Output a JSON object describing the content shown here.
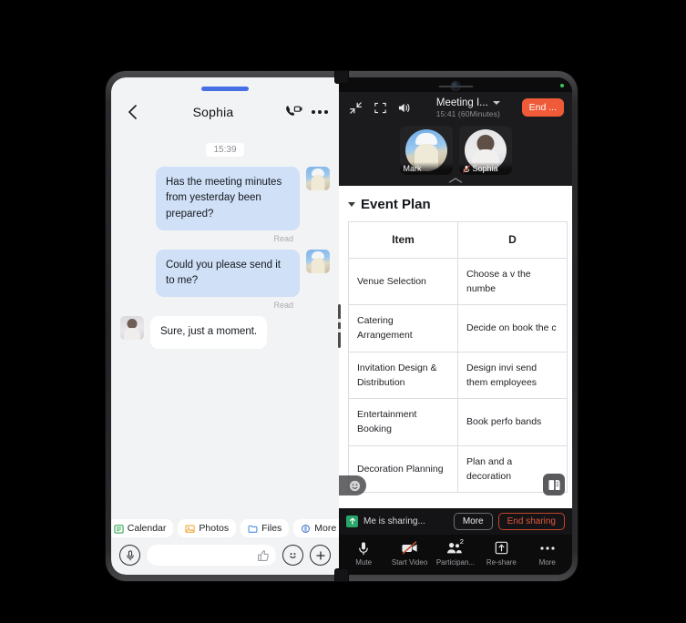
{
  "chat": {
    "title": "Sophia",
    "time_separator": "15:39",
    "messages": [
      {
        "sender": "Mark",
        "direction": "out",
        "text": "Has the meeting minutes from yesterday been prepared?",
        "status": "Read",
        "avatar": "mark-avatar"
      },
      {
        "sender": "Mark",
        "direction": "out",
        "text": "Could you please send it to me?",
        "status": "Read",
        "avatar": "mark-avatar"
      },
      {
        "sender": "Sophia",
        "direction": "in",
        "text": "Sure, just a moment.",
        "status": "",
        "avatar": "sophia-avatar"
      }
    ],
    "quick_actions": [
      {
        "label": "Calendar",
        "icon": "calendar-icon",
        "color": "#34a853"
      },
      {
        "label": "Photos",
        "icon": "photo-icon",
        "color": "#f0a83c"
      },
      {
        "label": "Files",
        "icon": "folder-icon",
        "color": "#4a90e2"
      },
      {
        "label": "More",
        "icon": "more-apps-icon",
        "color": "#4a78c8"
      }
    ],
    "composer": {
      "placeholder": "",
      "value": "",
      "mic_icon": "microphone-icon",
      "thumb_icon": "thumbs-up-icon",
      "emoji_icon": "emoji-icon",
      "plus_icon": "plus-icon"
    },
    "header_icons": {
      "back": "back-arrow-icon",
      "call": "video-call-icon",
      "more": "more-options-icon"
    }
  },
  "meeting": {
    "title": "Meeting I...",
    "timer": "15:41 (60Minutes)",
    "end_button": "End ...",
    "controls": {
      "minimize": "minimize-icon",
      "fullscreen": "fullscreen-icon",
      "speaker": "speaker-icon"
    },
    "participants": [
      {
        "name": "Mark",
        "muted": false,
        "avatar": "mark-avatar"
      },
      {
        "name": "Sophia",
        "muted": true,
        "avatar": "sophia-avatar"
      }
    ],
    "sharing": {
      "status": "Me is sharing...",
      "more_label": "More",
      "end_label": "End sharing"
    },
    "toolbar": [
      {
        "label": "Mute",
        "icon": "microphone-icon",
        "badge": ""
      },
      {
        "label": "Start Video",
        "icon": "video-off-icon",
        "badge": ""
      },
      {
        "label": "Participan...",
        "icon": "participants-icon",
        "badge": "2"
      },
      {
        "label": "Re-share",
        "icon": "share-up-icon",
        "badge": ""
      },
      {
        "label": "More",
        "icon": "more-dots-icon",
        "badge": ""
      }
    ]
  },
  "document": {
    "title": "Event Plan",
    "columns": [
      "Item",
      "D"
    ],
    "rows": [
      {
        "item": "Venue Selection",
        "detail": "Choose a v\nthe numbe"
      },
      {
        "item": "Catering Arrangement",
        "detail": "Decide on\nbook the c"
      },
      {
        "item": "Invitation Design & Distribution",
        "detail": "Design invi\nsend them\nemployees"
      },
      {
        "item": "Entertainment Booking",
        "detail": "Book perfo\nbands"
      },
      {
        "item": "Decoration Planning",
        "detail": "Plan and a\ndecoration"
      }
    ],
    "float_doc_icon": "document-icon"
  },
  "colors": {
    "accent_blue": "#4470e4",
    "bubble_out": "#cfe0f7",
    "end_red": "#ef5a38",
    "sharing_green": "#27a667"
  }
}
